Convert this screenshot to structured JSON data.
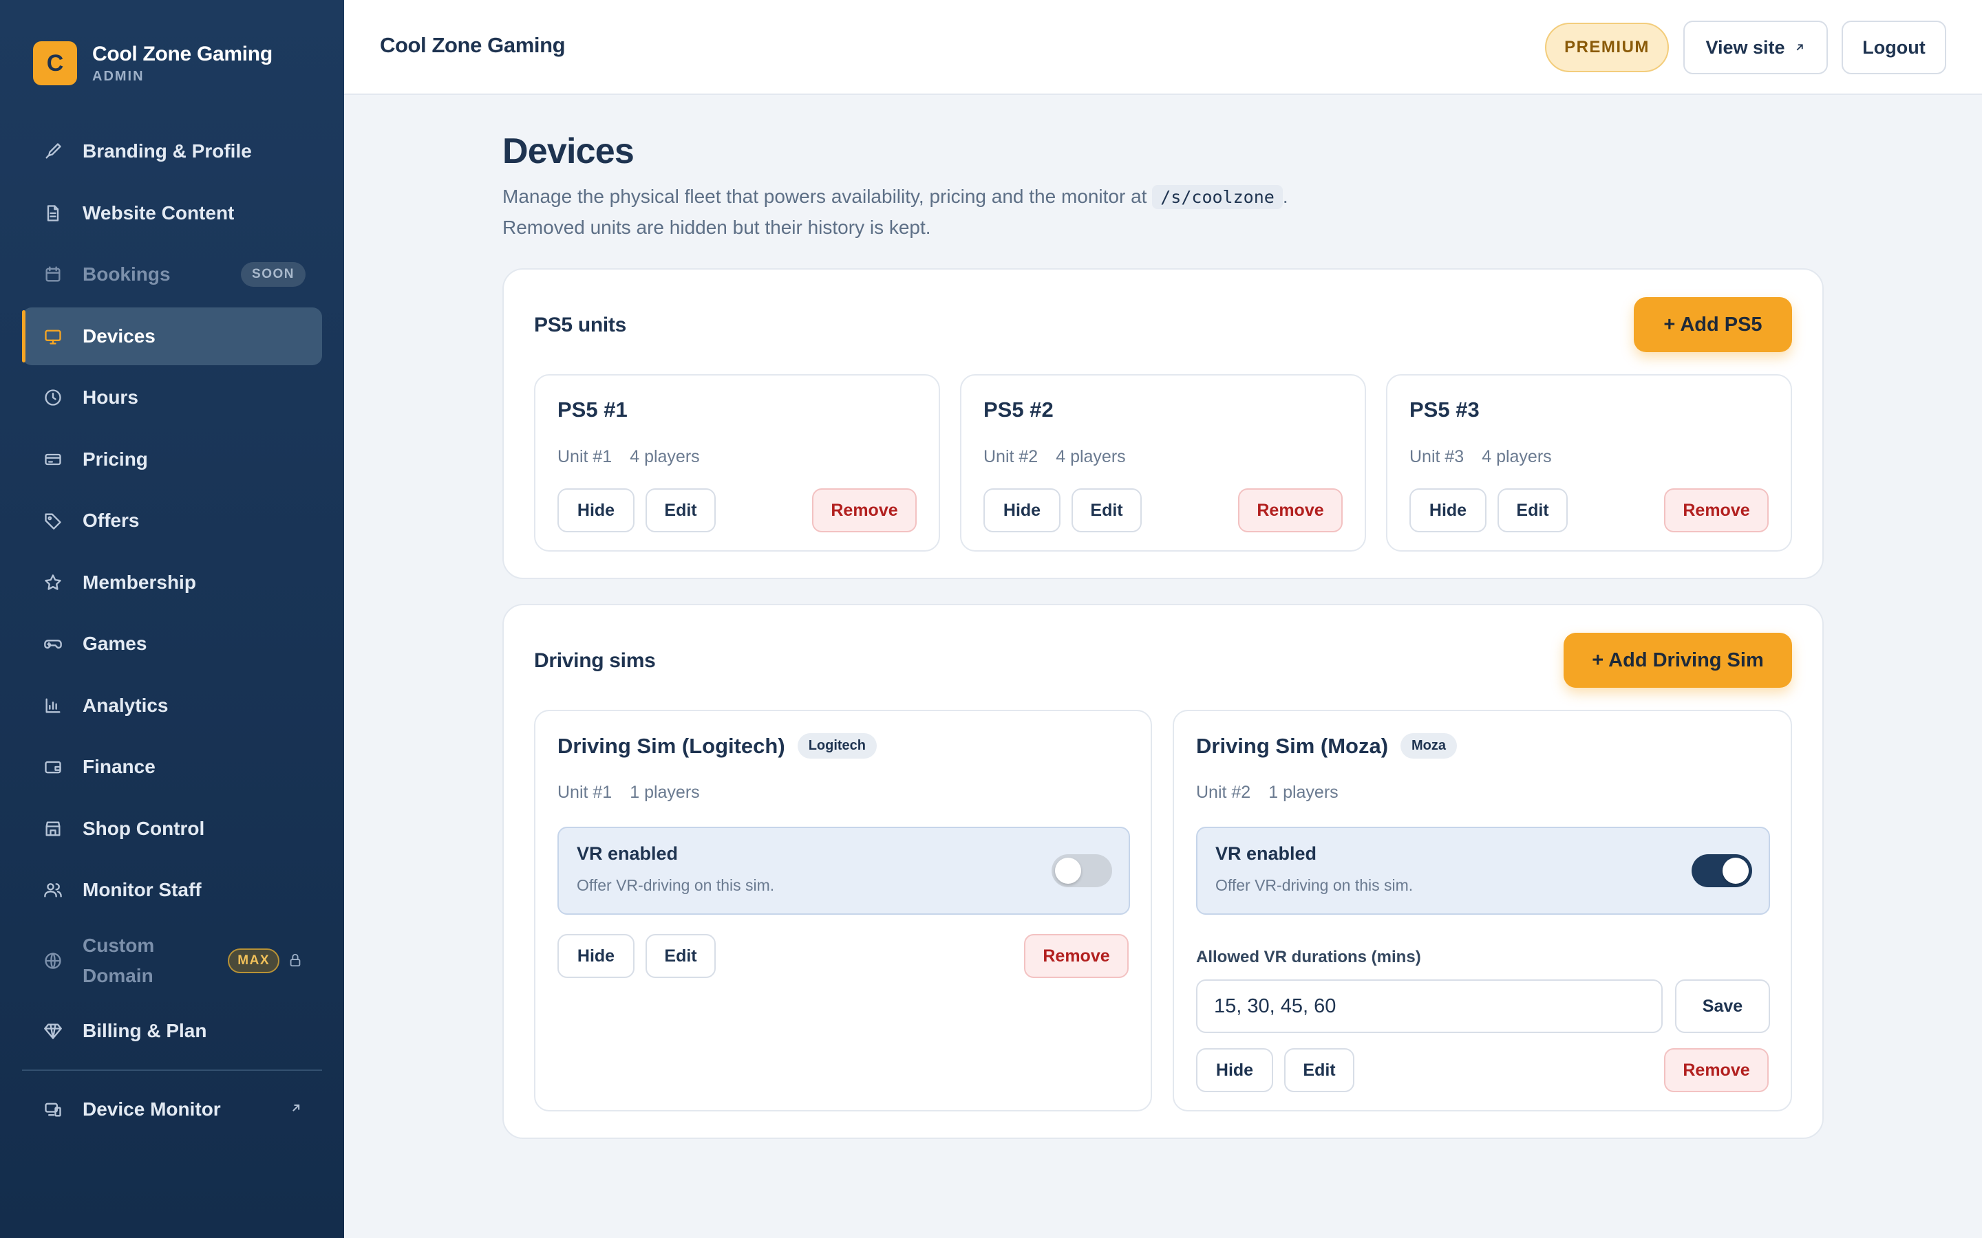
{
  "brand": {
    "logo_letter": "C",
    "name": "Cool Zone Gaming",
    "role": "ADMIN"
  },
  "sidebar": {
    "items": [
      {
        "label": "Branding & Profile",
        "icon": "brush-icon"
      },
      {
        "label": "Website Content",
        "icon": "document-icon"
      },
      {
        "label": "Bookings",
        "icon": "calendar-icon",
        "badge": "SOON"
      },
      {
        "label": "Devices",
        "icon": "monitor-icon"
      },
      {
        "label": "Hours",
        "icon": "clock-icon"
      },
      {
        "label": "Pricing",
        "icon": "card-icon"
      },
      {
        "label": "Offers",
        "icon": "tag-icon"
      },
      {
        "label": "Membership",
        "icon": "star-icon"
      },
      {
        "label": "Games",
        "icon": "gamepad-icon"
      },
      {
        "label": "Analytics",
        "icon": "bar-chart-icon"
      },
      {
        "label": "Finance",
        "icon": "wallet-icon"
      },
      {
        "label": "Shop Control",
        "icon": "store-icon"
      },
      {
        "label": "Monitor Staff",
        "icon": "users-icon"
      },
      {
        "label": "Custom Domain",
        "icon": "globe-icon",
        "badge": "MAX"
      },
      {
        "label": "Billing & Plan",
        "icon": "diamond-icon"
      }
    ],
    "footer_item": {
      "label": "Device Monitor",
      "icon": "monitor-link-icon"
    }
  },
  "topbar": {
    "title": "Cool Zone Gaming",
    "plan_badge": "PREMIUM",
    "view_site": "View site",
    "logout": "Logout"
  },
  "page": {
    "title": "Devices",
    "desc_before": "Manage the physical fleet that powers availability, pricing and the monitor at",
    "desc_code": "/s/coolzone",
    "desc_after": ".",
    "desc_line2": "Removed units are hidden but their history is kept."
  },
  "ps5": {
    "title": "PS5 units",
    "add_label": "+ Add PS5",
    "units": [
      {
        "name": "PS5 #1",
        "unit": "Unit #1",
        "players": "4 players"
      },
      {
        "name": "PS5 #2",
        "unit": "Unit #2",
        "players": "4 players"
      },
      {
        "name": "PS5 #3",
        "unit": "Unit #3",
        "players": "4 players"
      }
    ]
  },
  "sims": {
    "title": "Driving sims",
    "add_label": "+ Add Driving Sim",
    "units": [
      {
        "name": "Driving Sim (Logitech)",
        "tag": "Logitech",
        "unit": "Unit #1",
        "players": "1 players",
        "vr_enabled": false
      },
      {
        "name": "Driving Sim (Moza)",
        "tag": "Moza",
        "unit": "Unit #2",
        "players": "1 players",
        "vr_enabled": true
      }
    ],
    "vr_title": "VR enabled",
    "vr_sub": "Offer VR-driving on this sim.",
    "durations_label": "Allowed VR durations (mins)",
    "durations_value": "15, 30, 45, 60",
    "save_label": "Save"
  },
  "actions": {
    "hide": "Hide",
    "edit": "Edit",
    "remove": "Remove"
  },
  "colors": {
    "accent": "#f5a524",
    "sidebar": "#1d3a5e",
    "danger": "#b2201f",
    "toggle_on": "#1e3a5c"
  }
}
